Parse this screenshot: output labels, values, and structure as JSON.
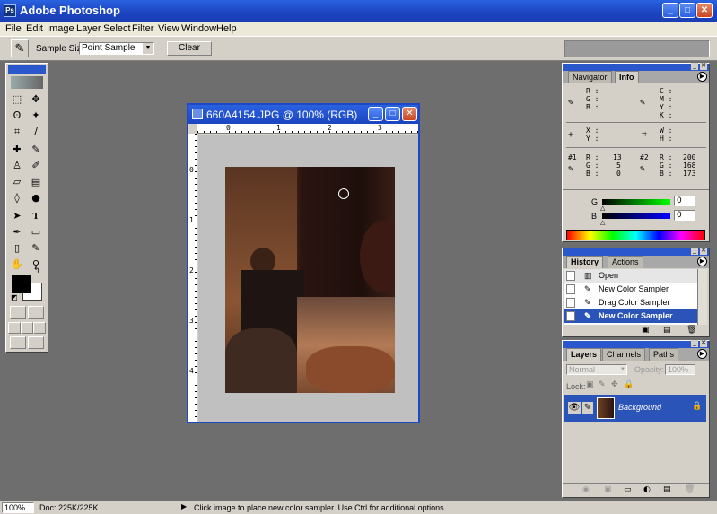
{
  "app": {
    "title": "Adobe Photoshop",
    "icon": "photoshop-icon"
  },
  "window_buttons": {
    "minimize": "_",
    "maximize": "□",
    "close": "✕"
  },
  "menu": [
    "File",
    "Edit",
    "Image",
    "Layer",
    "Select",
    "Filter",
    "View",
    "Window",
    "Help"
  ],
  "options": {
    "sample_size_label": "Sample Size:",
    "sample_size_value": "Point Sample",
    "clear_label": "Clear"
  },
  "document": {
    "title": "660A4154.JPG @ 100% (RGB)",
    "ruler_h": [
      "0",
      "1",
      "2",
      "3"
    ],
    "ruler_v": [
      "0",
      "1",
      "2",
      "3",
      "4"
    ]
  },
  "info_panel": {
    "tabs": [
      "Navigator",
      "Info"
    ],
    "rgb": {
      "r": "R :",
      "g": "G :",
      "b": "B :"
    },
    "cmyk": {
      "c": "C :",
      "m": "M :",
      "y": "Y :",
      "k": "K :"
    },
    "xy": {
      "x": "X :",
      "y": "Y :"
    },
    "wh": {
      "w": "W :",
      "h": "H :"
    },
    "sampler1": {
      "label": "#1",
      "r_label": "R :",
      "g_label": "G :",
      "b_label": "B :",
      "r": "13",
      "g": "5",
      "b": "0"
    },
    "sampler2": {
      "label": "#2",
      "r_label": "R :",
      "g_label": "G :",
      "b_label": "B :",
      "r": "200",
      "g": "168",
      "b": "173"
    }
  },
  "color_panel": {
    "g_label": "G",
    "g_value": "0",
    "b_label": "B",
    "b_value": "0"
  },
  "history_panel": {
    "tabs": [
      "History",
      "Actions"
    ],
    "items": [
      "Open",
      "New Color Sampler",
      "Drag Color Sampler",
      "New Color Sampler"
    ],
    "selected_index": 3
  },
  "layers_panel": {
    "tabs": [
      "Layers",
      "Channels",
      "Paths"
    ],
    "blend_mode": "Normal",
    "opacity_label": "Opacity:",
    "opacity_value": "100%",
    "lock_label": "Lock:",
    "layer_name": "Background"
  },
  "status": {
    "zoom": "100%",
    "doc": "Doc: 225K/225K",
    "hint": "Click image to place new color sampler.  Use Ctrl for additional options."
  },
  "colors": {
    "title_blue": "#1b44c0",
    "selection_blue": "#2b54b8",
    "workspace": "#6e6e6e"
  }
}
